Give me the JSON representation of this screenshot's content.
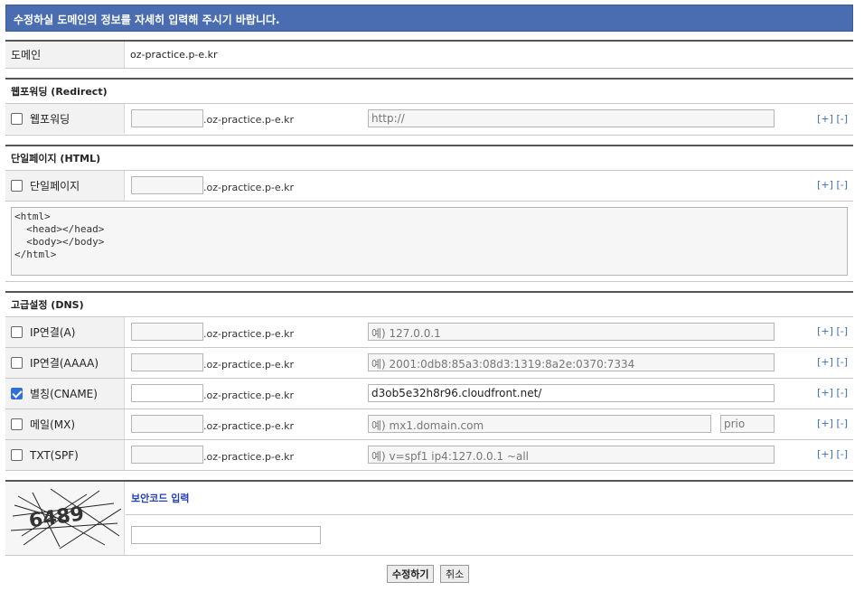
{
  "banner": "수정하실 도메인의 정보를 자세히 입력해 주시기 바랍니다.",
  "domain_row": {
    "label": "도메인",
    "value": "oz-practice.p-e.kr"
  },
  "suffix": ".oz-practice.p-e.kr",
  "add_remove": {
    "add": "[+]",
    "remove": "[-]"
  },
  "redirect": {
    "section": "웹포워딩 (Redirect)",
    "label": "웹포워딩",
    "checked": false,
    "url_value": "http://"
  },
  "html_page": {
    "section": "단일페이지 (HTML)",
    "label": "단일페이지",
    "checked": false,
    "content": "<html>\n  <head></head>\n  <body></body>\n</html>"
  },
  "dns": {
    "section": "고급설정 (DNS)",
    "records": [
      {
        "label": "IP연결(A)",
        "checked": false,
        "value": "",
        "placeholder": "예) 127.0.0.1"
      },
      {
        "label": "IP연결(AAAA)",
        "checked": false,
        "value": "",
        "placeholder": "예) 2001:0db8:85a3:08d3:1319:8a2e:0370:7334"
      },
      {
        "label": "별칭(CNAME)",
        "checked": true,
        "value": "d3ob5e32h8r96.cloudfront.net/",
        "placeholder": ""
      },
      {
        "label": "메일(MX)",
        "checked": false,
        "value": "",
        "placeholder": "예) mx1.domain.com",
        "prio_placeholder": "prio"
      },
      {
        "label": "TXT(SPF)",
        "checked": false,
        "value": "",
        "placeholder": "예) v=spf1 ip4:127.0.0.1 ~all"
      }
    ]
  },
  "captcha": {
    "title": "보안코드 입력",
    "image_text": "6489",
    "input_value": ""
  },
  "buttons": {
    "submit": "수정하기",
    "cancel": "취소"
  },
  "colors": {
    "banner": "#4a6db1",
    "link": "#3b6fb5",
    "captcha_title": "#2340b8"
  }
}
